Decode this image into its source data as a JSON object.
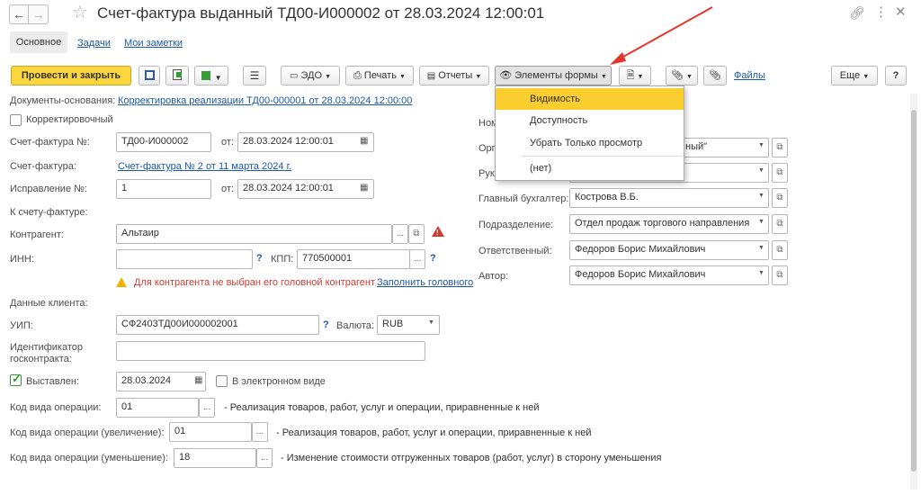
{
  "window": {
    "title": "Счет-фактура выданный ТД00-И000002 от 28.03.2024 12:00:01"
  },
  "nav_tabs": {
    "main": "Основное",
    "tasks": "Задачи",
    "notes": "Мои заметки"
  },
  "toolbar": {
    "post_close": "Провести и закрыть",
    "edo": "ЭДО",
    "print": "Печать",
    "reports": "Отчеты",
    "form_elements": "Элементы формы",
    "files": "Файлы",
    "more": "Еще",
    "help": "?"
  },
  "dropdown": {
    "items": [
      "Видимость",
      "Доступность",
      "Убрать Только просмотр",
      "(нет)"
    ]
  },
  "form": {
    "base_docs_label": "Документы-основания:",
    "base_docs_link": "Корректировка реализации ТД00-000001 от 28.03.2024 12:00:00",
    "corrective_label": "Корректировочный",
    "invoice_no_label": "Счет-фактура №:",
    "invoice_no": "ТД00-И000002",
    "from_label": "от:",
    "invoice_date": "28.03.2024 12:00:01",
    "invoice_label": "Счет-фактура:",
    "invoice_link": "Счет-фактура № 2 от 11 марта 2024 г.",
    "fix_no_label": "Исправление №:",
    "fix_no": "1",
    "fix_from_label": "от:",
    "fix_date": "28.03.2024 12:00:01",
    "to_invoice_label": "К счету-фактуре:",
    "contractor_label": "Контрагент:",
    "contractor": "Альтаир",
    "inn_label": "ИНН:",
    "inn": "",
    "inn_help": "?",
    "kpp_label": "КПП:",
    "kpp": "770500001",
    "kpp_help": "?",
    "warning_text": "Для контрагента не выбран его головной контрагент",
    "fill_head_link": "Заполнить головного",
    "client_data_label": "Данные клиента:",
    "uip_label": "УИП:",
    "uip": "СФ2403ТД00И000002001",
    "uip_help": "?",
    "currency_label": "Валюта:",
    "currency": "RUB",
    "gov_id_label_1": "Идентификатор",
    "gov_id_label_2": "госконтракта:",
    "gov_id": "",
    "issued_label": "Выставлен:",
    "issued_date": "28.03.2024",
    "electronic_label": "В электронном виде",
    "op_code_label": "Код вида операции:",
    "op_code": "01",
    "op_code_desc": "- Реализация товаров, работ, услуг и операции, приравненные к ней",
    "op_code_inc_label": "Код вида операции (увеличение):",
    "op_code_inc": "01",
    "op_code_inc_desc": "- Реализация товаров, работ, услуг и операции, приравненные к ней",
    "op_code_dec_label": "Код вида операции (уменьшение):",
    "op_code_dec": "18",
    "op_code_dec_desc": "- Изменение стоимости отгруженных товаров (работ, услуг) в сторону уменьшения",
    "ellipsis": "..."
  },
  "right_panel": {
    "number_label": "Ном",
    "org_label": "Орг",
    "org_value": "ный\"",
    "head_label": "Рук",
    "chief_acc_label": "Главный бухгалтер:",
    "chief_acc": "Кострова В.Б.",
    "division_label": "Подразделение:",
    "division": "Отдел продаж торгового направления",
    "responsible_label": "Ответственный:",
    "responsible": "Федоров Борис Михайлович",
    "author_label": "Автор:",
    "author": "Федоров Борис Михайлович"
  },
  "colors": {
    "accent_yellow": "#fbd63c",
    "selected_yellow": "#fbce2f",
    "link_blue": "#1c59a8",
    "warning_red": "#d63a2f",
    "arrow_red": "#e8352b",
    "checkbox_green": "#3a9a3a"
  }
}
